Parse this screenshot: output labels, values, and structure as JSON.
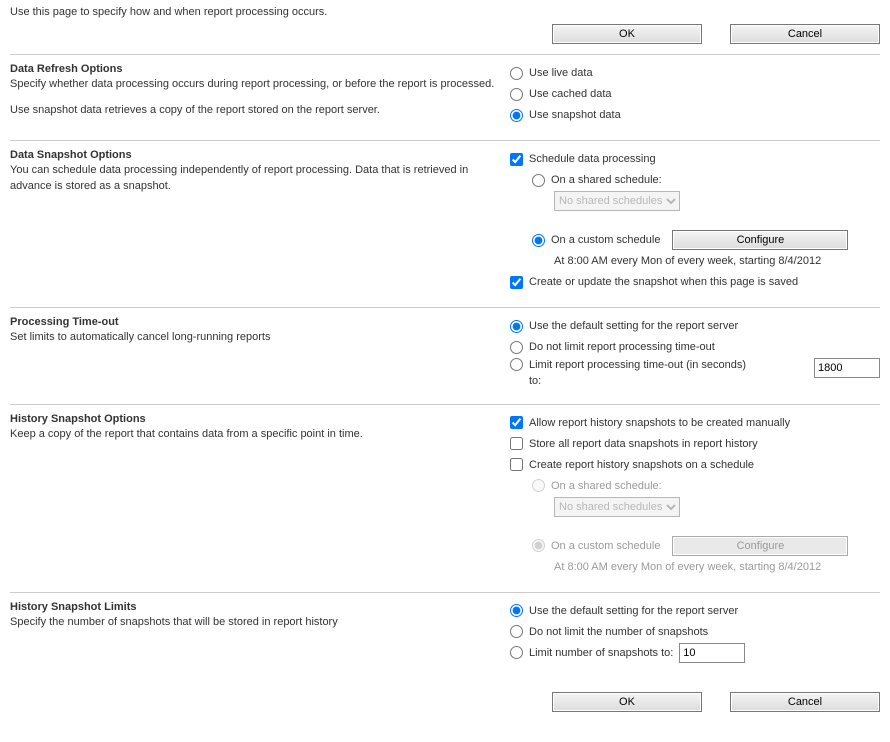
{
  "intro": "Use this page to specify how and when report processing occurs.",
  "buttons": {
    "ok": "OK",
    "cancel": "Cancel",
    "configure": "Configure"
  },
  "refresh": {
    "title": "Data Refresh Options",
    "desc": "Specify whether data processing occurs during report processing, or before the report is processed.",
    "note": "Use snapshot data retrieves a copy of the report stored on the report server.",
    "live": "Use live data",
    "cached": "Use cached data",
    "snapshot": "Use snapshot data"
  },
  "snapshot": {
    "title": "Data Snapshot Options",
    "desc": "You can schedule data processing independently of report processing. Data that is retrieved in advance is stored as a snapshot.",
    "schedule": "Schedule data processing",
    "shared": "On a shared schedule:",
    "sharedSelect": "No shared schedules",
    "custom": "On a custom schedule",
    "scheduleText": "At 8:00 AM every Mon of every week, starting 8/4/2012",
    "createOnSave": "Create or update the snapshot when this page is saved"
  },
  "timeout": {
    "title": "Processing Time-out",
    "desc": "Set limits to automatically cancel long-running reports",
    "default": "Use the default setting for the report server",
    "noLimit": "Do not limit report processing time-out",
    "limit": "Limit report processing time-out (in seconds) to:",
    "value": "1800"
  },
  "history": {
    "title": "History Snapshot Options",
    "desc": "Keep a copy of the report that contains data from a specific point in time.",
    "allowManual": "Allow report history snapshots to be created manually",
    "storeAll": "Store all report data snapshots in report history",
    "onSchedule": "Create report history snapshots on a schedule",
    "shared": "On a shared schedule:",
    "sharedSelect": "No shared schedules",
    "custom": "On a custom schedule",
    "scheduleText": "At 8:00 AM every Mon of every week, starting 8/4/2012"
  },
  "limits": {
    "title": "History Snapshot Limits",
    "desc": "Specify the number of snapshots that will be stored in report history",
    "default": "Use the default setting for the report server",
    "noLimit": "Do not limit the number of snapshots",
    "limit": "Limit number of snapshots to:",
    "value": "10"
  }
}
